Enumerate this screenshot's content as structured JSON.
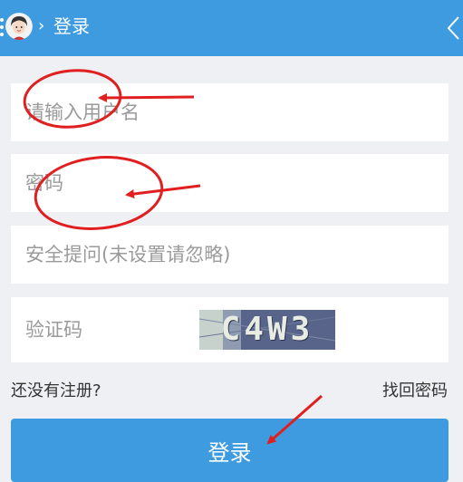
{
  "header": {
    "title": "登录",
    "crumb_separator": "›",
    "background_color": "#3e9be0",
    "menu_icon": "menu-dots-icon",
    "avatar_icon": "user-avatar-icon",
    "back_icon": "chevron-left-icon"
  },
  "form": {
    "username_placeholder": "请输入用户名",
    "password_placeholder": "密码",
    "security_hint_placeholder": "安全提问(未设置请忽略)",
    "captcha_placeholder": "验证码",
    "captcha_image_text": "C4W3"
  },
  "links": {
    "register": "还没有注册?",
    "forgot_password": "找回密码"
  },
  "login_button_label": "登录",
  "annotation_color": "#e02020"
}
